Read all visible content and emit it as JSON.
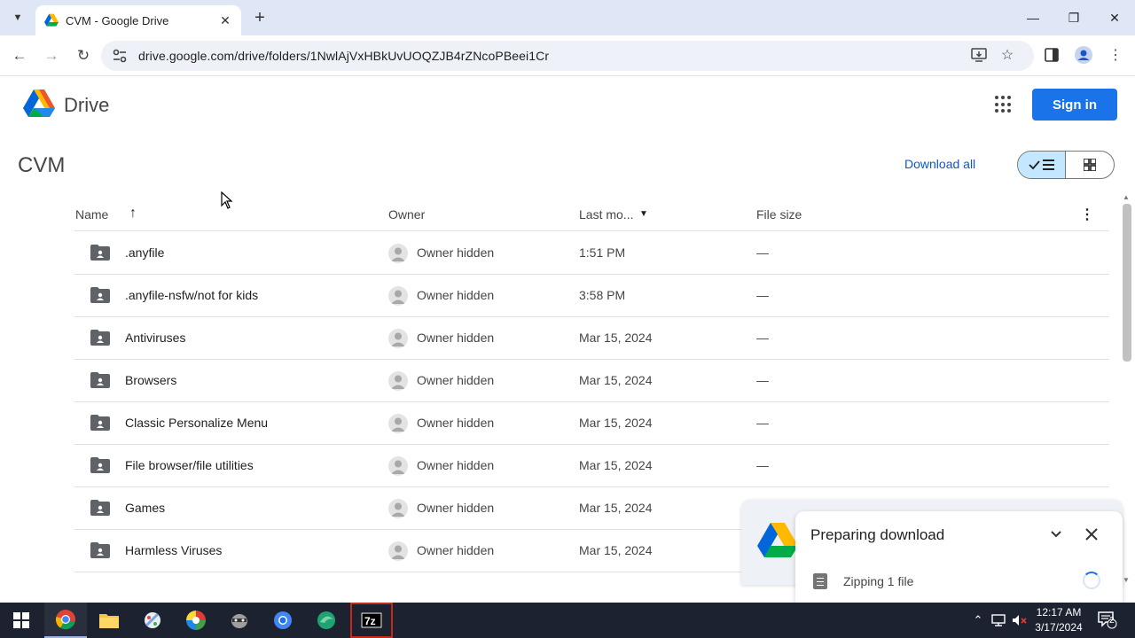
{
  "browser": {
    "tab_title": "CVM - Google Drive",
    "tab_close": "✕",
    "new_tab": "+",
    "url": "drive.google.com/drive/folders/1NwlAjVxHBkUvUOQZJB4rZNcoPBeei1Cr",
    "window_controls": [
      "—",
      "❐",
      "✕"
    ]
  },
  "drive": {
    "app_name": "Drive",
    "sign_in": "Sign in",
    "folder_title": "CVM",
    "download_all": "Download all"
  },
  "table": {
    "columns": {
      "name": "Name",
      "owner": "Owner",
      "last_modified": "Last mo...",
      "file_size": "File size"
    },
    "rows": [
      {
        "name": ".anyfile",
        "owner": "Owner hidden",
        "modified": "1:51 PM",
        "size": "—"
      },
      {
        "name": ".anyfile-nsfw/not for kids",
        "owner": "Owner hidden",
        "modified": "3:58 PM",
        "size": "—"
      },
      {
        "name": "Antiviruses",
        "owner": "Owner hidden",
        "modified": "Mar 15, 2024",
        "size": "—"
      },
      {
        "name": "Browsers",
        "owner": "Owner hidden",
        "modified": "Mar 15, 2024",
        "size": "—"
      },
      {
        "name": "Classic Personalize Menu",
        "owner": "Owner hidden",
        "modified": "Mar 15, 2024",
        "size": "—"
      },
      {
        "name": "File browser/file utilities",
        "owner": "Owner hidden",
        "modified": "Mar 15, 2024",
        "size": "—"
      },
      {
        "name": "Games",
        "owner": "Owner hidden",
        "modified": "Mar 15, 2024",
        "size": ""
      },
      {
        "name": "Harmless Viruses",
        "owner": "Owner hidden",
        "modified": "Mar 15, 2024",
        "size": ""
      }
    ]
  },
  "download_panel": {
    "title": "Preparing download",
    "status": "Zipping 1 file"
  },
  "taskbar": {
    "time": "12:17 AM",
    "date": "3/17/2024",
    "notification_count": "2"
  },
  "colors": {
    "accent": "#1a73e8",
    "tabstrip": "#dfe7f7",
    "taskbar": "#1c2230"
  }
}
